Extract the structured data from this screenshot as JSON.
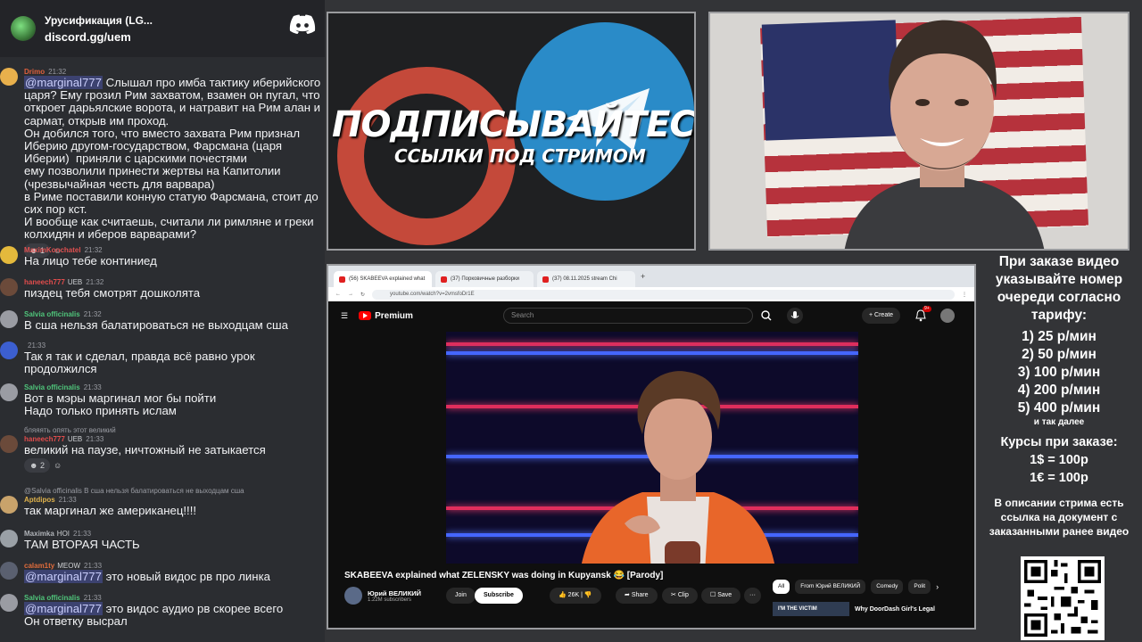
{
  "discord": {
    "server_name": "Урусификация (LG...",
    "invite": "discord.gg/uem",
    "messages": [
      {
        "user": "Drimo",
        "user_color": "#e0603c",
        "time": "21:32",
        "mention": "@marginal777",
        "text": " Слышал про имба тактику иберийского царя? Ему грозил Рим захватом, взамен он пугал, что откроет дарьялские ворота, и натравит на Рим алан и сармат, открыв им проход.\nОн добился того, что вместо захвата Рим признал Иберию другом-государством, Фарсмана (царя Иберии)  приняли с царскими почестями\nему позволили принести жертвы на Капитолии (чрезвычайная честь для варвара)\nв Риме поставили конную статую Фарсмана, стоит до сих пор кст.\nИ вообще как считаешь, считали ли римляне и греки колхидян и иберов варварами?",
        "reaction_count": "1"
      },
      {
        "user": "MaximKonchatel",
        "user_color": "#e05050",
        "time": "21:32",
        "mention": "",
        "text": "На лицо тебе континиед"
      },
      {
        "user": "haneech777",
        "user_color": "#e04c4c",
        "time": "21:32",
        "mention": "",
        "text": "пиздец тебя смотрят дошколята",
        "badge": "UEB"
      },
      {
        "user": "Salvia officinalis",
        "user_color": "#4fc47a",
        "time": "21:32",
        "mention": "",
        "text": "В сша нельзя балатироваться не выходцам сша"
      },
      {
        "user": "",
        "user_color": "#e0c64c",
        "time": "21:33",
        "mention": "",
        "text": "Так я так и сделал, правда всё равно урок продолжился"
      },
      {
        "user": "Salvia officinalis",
        "user_color": "#4fc47a",
        "time": "21:33",
        "mention": "",
        "text": "Вот в мэры маргинал мог бы пойти\nНадо только принять ислам"
      },
      {
        "reply": "бляяять опять этот великий",
        "user": "haneech777",
        "user_color": "#e04c4c",
        "time": "21:33",
        "mention": "",
        "text": "великий на паузе, ничтожный не затыкается",
        "reaction_count": "2",
        "badge": "UEB"
      },
      {
        "reply": "@Salvia officinalis В сша нельзя балатироваться не выходцам сша",
        "user": "Aptdipos",
        "user_color": "#e0b34c",
        "time": "21:33",
        "mention": "",
        "text": "так маргинал же американец!!!!"
      },
      {
        "user": "Maximka",
        "user_color": "#b0b3b8",
        "time": "21:33",
        "mention": "",
        "text": "ТАМ ВТОРАЯ ЧАСТЬ",
        "badge": "HOI"
      },
      {
        "user": "calam1ty",
        "user_color": "#e06c3c",
        "time": "21:33",
        "mention": "@marginal777",
        "text": " это новый видос рв про линка",
        "badge": "MEOW"
      },
      {
        "user": "Salvia officinalis",
        "user_color": "#4fc47a",
        "time": "21:33",
        "mention": "@marginal777",
        "text": " это видос аудио рв скорее всего\nОн ответку высрал"
      }
    ]
  },
  "promo": {
    "title": "ПОДПИСЫВАЙТЕСЬ",
    "subtitle": "ССЫЛКИ ПОД СТРИМОМ"
  },
  "browser": {
    "tabs": [
      {
        "label": "(56) SKABEEVA explained what"
      },
      {
        "label": "(37) Порковичные разборки"
      },
      {
        "label": "(37) 08.11.2025 stream Chi"
      }
    ],
    "url": "youtube.com/watch?v=2vmsfoDr1E",
    "yt": {
      "premium": "Premium",
      "search_placeholder": "Search",
      "create": "Create",
      "notif_count": "9+",
      "video_title": "SKABEEVA explained what ZELENSKY was doing in Kupyansk 😂 [Parody]",
      "channel": "Юрий ВЕЛИКИЙ",
      "subscribers": "1.22M subscribers",
      "join": "Join",
      "subscribe": "Subscribe",
      "likes": "26K",
      "share": "Share",
      "clip": "Clip",
      "save": "Save",
      "chips": [
        "All",
        "From Юрий ВЕЛИКИЙ",
        "Comedy",
        "Polit"
      ],
      "rec_thumb_text": "I'M THE VICTIM",
      "rec_title": "Why DoorDash Girl's Legal"
    }
  },
  "info": {
    "heading": "При заказе видео указывайте номер очереди согласно тарифу:",
    "prices": [
      "1) 25 р/мин",
      "2) 50 р/мин",
      "3) 100 р/мин",
      "4) 200 р/мин",
      "5) 400 р/мин"
    ],
    "etc": "и так далее",
    "rates_title": "Курсы при заказе:",
    "rates": [
      "1$ = 100р",
      "1€ = 100р"
    ],
    "footer": "В описании стрима есть ссылка на документ с заказанными ранее видео"
  }
}
